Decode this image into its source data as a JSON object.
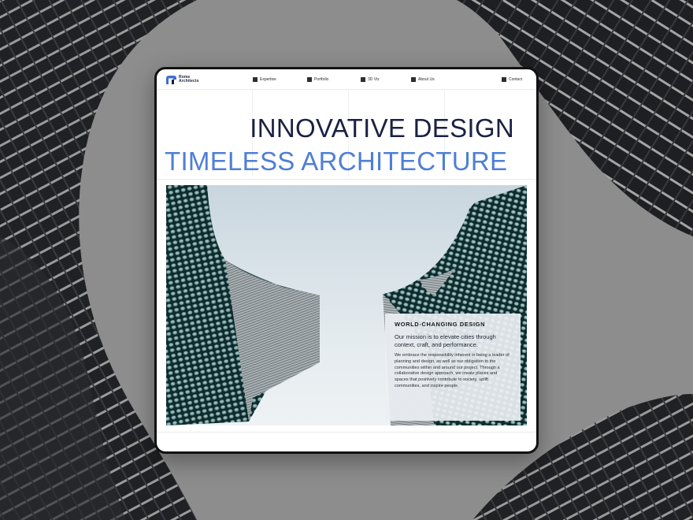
{
  "brand": {
    "logo_text": "Rome\nArchitects",
    "logo_color": "#3f6fd2"
  },
  "nav": {
    "items": [
      {
        "label": "Expertise"
      },
      {
        "label": "Portfolio"
      },
      {
        "label": "3D Viz"
      },
      {
        "label": "About Us"
      },
      {
        "label": "Contact"
      }
    ]
  },
  "hero": {
    "line1": "INNOVATIVE DESIGN",
    "line2": "TIMELESS ARCHITECTURE",
    "line1_color": "#1b2142",
    "line2_color": "#4f7fd4"
  },
  "card": {
    "title": "WORLD-CHANGING DESIGN",
    "lead": "Our mission is to elevate cities through context, craft, and performance.",
    "body": "We embrace the responsibility inherent in being a leader of planning and design, as well as our obligation to the communities within and around our project. Through a collaborative design approach, we create places and spaces that positively contribute to society, uplift communities, and inspire people."
  }
}
